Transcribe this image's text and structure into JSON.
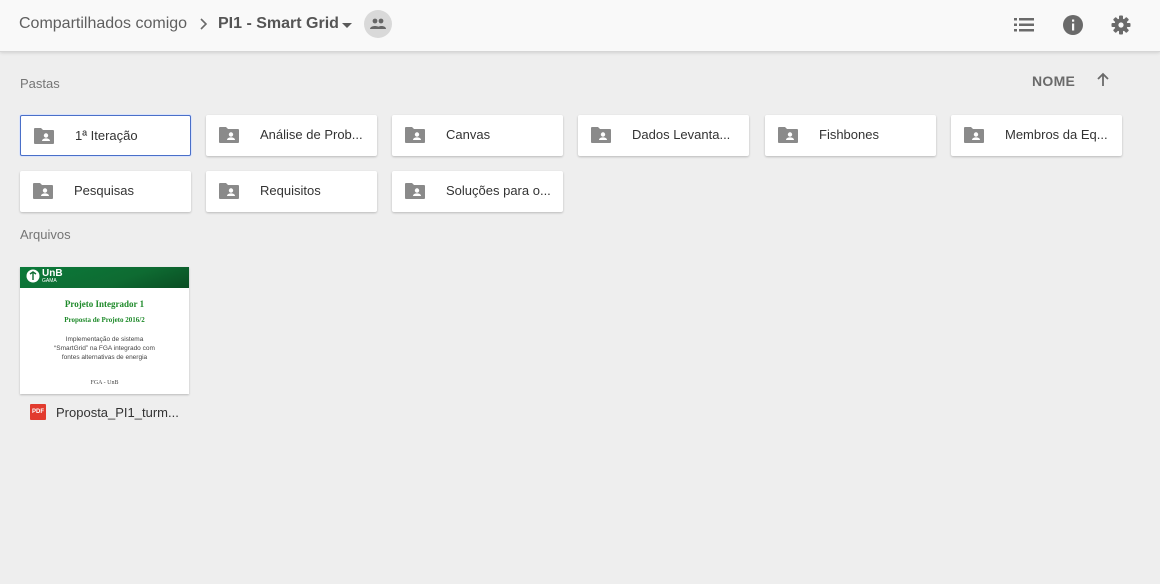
{
  "breadcrumb": {
    "root": "Compartilhados comigo",
    "current": "PI1 - Smart Grid"
  },
  "toolbar": {
    "icons": [
      "list-view-icon",
      "info-icon",
      "settings-icon"
    ]
  },
  "sections": {
    "folders_label": "Pastas",
    "files_label": "Arquivos"
  },
  "sort": {
    "label": "NOME",
    "direction": "ascending"
  },
  "folders": [
    {
      "name": "1ª Iteração",
      "selected": true
    },
    {
      "name": "Análise de Prob..."
    },
    {
      "name": "Canvas"
    },
    {
      "name": "Dados Levanta..."
    },
    {
      "name": "Fishbones"
    },
    {
      "name": "Membros da Eq..."
    },
    {
      "name": "Pesquisas"
    },
    {
      "name": "Requisitos"
    },
    {
      "name": "Soluções para o..."
    }
  ],
  "files": [
    {
      "name": "Proposta_PI1_turm...",
      "type": "PDF",
      "thumbnail": {
        "logo": "UnB",
        "logo_sub": "GAMA",
        "title": "Projeto Integrador 1",
        "subtitle": "Proposta de Projeto 2016/2",
        "body": [
          "Implementação de sistema",
          "“SmartGrid” na FGA integrado com",
          "fontes alternativas de energia"
        ],
        "footer": "FGA - UnB"
      }
    }
  ],
  "colors": {
    "background": "#eeeeee",
    "topbar": "#f9f9f9",
    "selected_border": "#4a6fc8",
    "icon_gray": "#757575",
    "pdf_red": "#e23b2e",
    "unb_green": "#0e6b32"
  }
}
